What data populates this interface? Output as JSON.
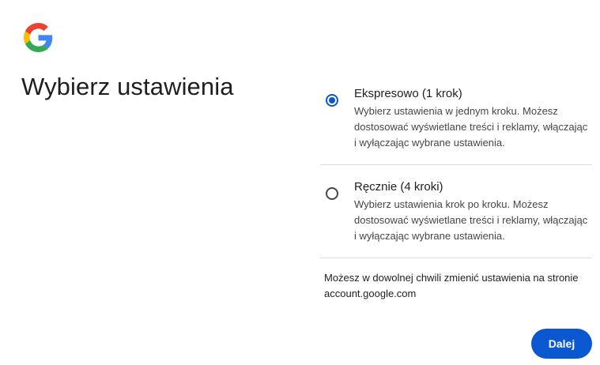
{
  "header": {
    "logo_icon": "google-g-logo-icon",
    "title": "Wybierz ustawienia"
  },
  "options": [
    {
      "title": "Ekspresowo (1 krok)",
      "description": "Wybierz ustawienia w jednym kroku. Możesz dostosować wyświetlane treści i reklamy, włączając i wyłączając wybrane ustawienia.",
      "selected": true
    },
    {
      "title": "Ręcznie (4 kroki)",
      "description": "Wybierz ustawienia krok po kroku. Możesz dostosować wyświetlane treści i reklamy, włączając i wyłączając wybrane ustawienia.",
      "selected": false
    }
  ],
  "note": "Możesz w dowolnej chwili zmienić ustawienia na stronie account.google.com",
  "actions": {
    "next_label": "Dalej"
  },
  "colors": {
    "accent": "#0b57d0",
    "text": "#1f1f1f",
    "secondary_text": "#444746",
    "divider": "#dadce0"
  }
}
